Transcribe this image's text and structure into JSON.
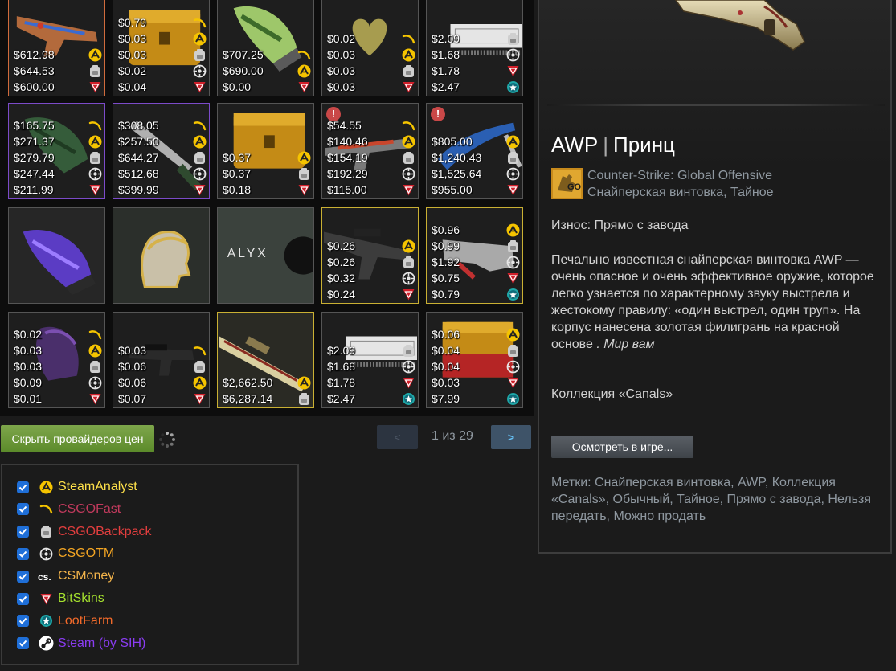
{
  "providers": [
    {
      "id": "sa",
      "label": "SteamAnalyst",
      "color": "#ffe14a",
      "icon": "steamanalyst-icon"
    },
    {
      "id": "fast",
      "label": "CSGOFast",
      "color": "#c23a5d",
      "icon": "csgofast-icon"
    },
    {
      "id": "bp",
      "label": "CSGOBackpack",
      "color": "#e23e3e",
      "icon": "csgobackpack-icon"
    },
    {
      "id": "tm",
      "label": "CSGOTM",
      "color": "#f5a623",
      "icon": "csgotm-icon"
    },
    {
      "id": "money",
      "label": "CSMoney",
      "color": "#f2b34a",
      "icon": "csmoney-icon"
    },
    {
      "id": "bit",
      "label": "BitSkins",
      "color": "#a6e22e",
      "icon": "bitskins-icon"
    },
    {
      "id": "loot",
      "label": "LootFarm",
      "color": "#f26a2a",
      "icon": "lootfarm-icon"
    },
    {
      "id": "steam",
      "label": "Steam (by SIH)",
      "color": "#8a3cf2",
      "icon": "steam-icon"
    }
  ],
  "inventory": {
    "items": [
      {
        "name": "m4a4-skin",
        "border": "#d06b3c",
        "art": "rifle",
        "prices": [
          [
            "$612.98",
            "sa"
          ],
          [
            "$644.53",
            "bp"
          ],
          [
            "$600.00",
            "bit"
          ]
        ]
      },
      {
        "name": "weapon-case",
        "border": "#555",
        "art": "case",
        "prices": [
          [
            "$0.79",
            "fast"
          ],
          [
            "$0.03",
            "sa"
          ],
          [
            "$0.03",
            "bp"
          ],
          [
            "$0.02",
            "tm"
          ],
          [
            "$0.04",
            "bit"
          ]
        ]
      },
      {
        "name": "sport-gloves",
        "border": "#555",
        "art": "gloves-green",
        "prices": [
          [
            "$707.25",
            "fast"
          ],
          [
            "$690.00",
            "sa"
          ],
          [
            "$0.00",
            "bit"
          ]
        ]
      },
      {
        "name": "heart-sticker",
        "border": "#555",
        "art": "heart",
        "prices": [
          [
            "$0.02",
            "fast"
          ],
          [
            "$0.03",
            "sa"
          ],
          [
            "$0.03",
            "bp"
          ],
          [
            "$0.03",
            "bit"
          ]
        ]
      },
      {
        "name": "name-tag",
        "border": "#555",
        "art": "nametag",
        "prices": [
          [
            "$2.09",
            "bp"
          ],
          [
            "$1.68",
            "tm"
          ],
          [
            "$1.78",
            "bit"
          ],
          [
            "$2.47",
            "loot"
          ]
        ]
      },
      {
        "name": "gloves-dark-green",
        "border": "#7c4bc9",
        "art": "gloves-dark",
        "prices": [
          [
            "$165.75",
            "fast"
          ],
          [
            "$271.37",
            "sa"
          ],
          [
            "$279.79",
            "bp"
          ],
          [
            "$247.44",
            "tm"
          ],
          [
            "$211.99",
            "bit"
          ]
        ]
      },
      {
        "name": "knife",
        "border": "#7c4bc9",
        "art": "knife",
        "prices": [
          [
            "$308.05",
            "fast"
          ],
          [
            "$257.50",
            "sa"
          ],
          [
            "$644.27",
            "bp"
          ],
          [
            "$512.68",
            "tm"
          ],
          [
            "$399.99",
            "bit"
          ]
        ]
      },
      {
        "name": "gold-case",
        "border": "#555",
        "art": "case",
        "prices": [
          [
            "$0.37",
            "sa"
          ],
          [
            "$0.37",
            "bp"
          ],
          [
            "$0.18",
            "bit"
          ]
        ]
      },
      {
        "name": "ak47-skin",
        "border": "#555",
        "art": "ak",
        "warn": true,
        "prices": [
          [
            "$54.55",
            "fast"
          ],
          [
            "$140.46",
            "sa"
          ],
          [
            "$154.19",
            "bp"
          ],
          [
            "$192.29",
            "tm"
          ],
          [
            "$115.00",
            "bit"
          ]
        ]
      },
      {
        "name": "knife-blue",
        "border": "#555",
        "art": "knife-blue",
        "warn": true,
        "prices": [
          [
            "$805.00",
            "sa"
          ],
          [
            "$1,240.43",
            "bp"
          ],
          [
            "$1,525.64",
            "tm"
          ],
          [
            "$955.00",
            "bit"
          ]
        ]
      },
      {
        "name": "purple-gloves",
        "border": "#555",
        "art": "gloves-purple",
        "prices": []
      },
      {
        "name": "agent-patch",
        "border": "#555",
        "art": "portrait",
        "prices": []
      },
      {
        "name": "music-kit-alyx",
        "border": "#555",
        "art": "alyx",
        "art_text": "ALYX",
        "prices": []
      },
      {
        "name": "sniper-rifle",
        "border": "#c9b033",
        "art": "sniper",
        "prices": [
          [
            "$0.26",
            "sa"
          ],
          [
            "$0.26",
            "bp"
          ],
          [
            "$0.32",
            "tm"
          ],
          [
            "$0.24",
            "bit"
          ]
        ]
      },
      {
        "name": "p90-skin",
        "border": "#c9b033",
        "art": "p90",
        "prices": [
          [
            "$0.96",
            "sa"
          ],
          [
            "$0.99",
            "bp"
          ],
          [
            "$1.92",
            "tm"
          ],
          [
            "$0.75",
            "bit"
          ],
          [
            "$0.79",
            "loot"
          ]
        ]
      },
      {
        "name": "purple-sticker",
        "border": "#555",
        "art": "sticker-purple",
        "prices": [
          [
            "$0.02",
            "fast"
          ],
          [
            "$0.03",
            "sa"
          ],
          [
            "$0.03",
            "bp"
          ],
          [
            "$0.09",
            "tm"
          ],
          [
            "$0.01",
            "bit"
          ]
        ]
      },
      {
        "name": "smg-skin",
        "border": "#555",
        "art": "smg",
        "prices": [
          [
            "$0.03",
            "fast"
          ],
          [
            "$0.06",
            "bp"
          ],
          [
            "$0.06",
            "sa"
          ],
          [
            "$0.07",
            "bit"
          ]
        ]
      },
      {
        "name": "awp-prince",
        "border": "#c9b033",
        "art": "awp",
        "prices": [
          [
            "$2,662.50",
            "sa"
          ],
          [
            "$6,287.14",
            "bp"
          ]
        ]
      },
      {
        "name": "name-tag-2",
        "border": "#555",
        "art": "nametag",
        "prices": [
          [
            "$2.09",
            "bp"
          ],
          [
            "$1.68",
            "tm"
          ],
          [
            "$1.78",
            "bit"
          ],
          [
            "$2.47",
            "loot"
          ]
        ]
      },
      {
        "name": "red-case",
        "border": "#555",
        "art": "case-red",
        "prices": [
          [
            "$0.06",
            "sa"
          ],
          [
            "$0.04",
            "bp"
          ],
          [
            "$0.04",
            "tm"
          ],
          [
            "$0.03",
            "bit"
          ],
          [
            "$7.99",
            "loot"
          ]
        ]
      }
    ]
  },
  "controls": {
    "hide_providers_label": "Скрыть провайдеров цен",
    "prev_label": "<",
    "next_label": ">",
    "page_text": "1 из 29"
  },
  "details": {
    "title_weapon": "AWP",
    "title_sep": "|",
    "title_skin": "Принц",
    "game_name": "Counter-Strike: Global Offensive",
    "item_type": "Снайперская винтовка, Тайное",
    "wear": "Износ: Прямо с завода",
    "description": "Печально известная снайперская винтовка AWP — очень опасное и очень эффективное оружие, которое легко узнается по характерному звуку выстрела и жестокому правилу: «один выстрел, один труп». На корпус нанесена золотая филигрань на красной основе",
    "description_quote": ". Мир вам",
    "collection": "Коллекция «Canals»",
    "inspect_label": "Осмотреть в игре...",
    "tags": "Метки: Снайперская винтовка, AWP, Коллекция «Canals», Обычный, Тайное, Прямо с завода, Нельзя передать, Можно продать",
    "game_badge": "GO"
  }
}
